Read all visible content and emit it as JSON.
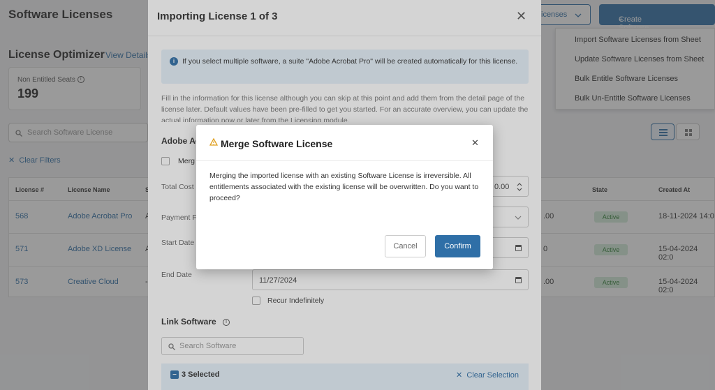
{
  "page": {
    "title": "Software Licenses",
    "subtitle": "License Optimizer",
    "view_details": "View Details",
    "stat_label": "Non Entitled Seats",
    "stat_value": "199",
    "search_placeholder": "Search Software License",
    "clear_filters": "Clear Filters",
    "top_button_outline": "icenses",
    "top_button_primary": "Create Software License",
    "dropdown": [
      "Import Software Licenses from Sheet",
      "Update Software Licenses from Sheet",
      "Bulk Entitle Software Licenses",
      "Bulk Un-Entitle Software Licenses"
    ],
    "table": {
      "headers": [
        "License #",
        "License Name",
        "S",
        "State",
        "Created At"
      ],
      "rows": [
        {
          "num": "568",
          "name": "Adobe Acrobat Pro",
          "s": "A",
          "amount": ".00",
          "state": "Active",
          "created": "18-11-2024 14:0"
        },
        {
          "num": "571",
          "name": "Adobe XD License",
          "s": "A",
          "amount": "0",
          "state": "Active",
          "created": "15-04-2024 02:0"
        },
        {
          "num": "573",
          "name": "Creative Cloud",
          "s": "-",
          "amount": ".00",
          "state": "Active",
          "created": "15-04-2024 02:0"
        }
      ]
    }
  },
  "import_modal": {
    "title": "Importing License 1 of 3",
    "info": "If you select multiple software, a suite \"Adobe Acrobat Pro\" will be created automatically for this license.",
    "help": "Fill in the information for this license although you can skip at this point and add them from the detail page of the license later. Default values have been pre-filled to get you started. For an accurate overview, you can update the actual information now or later from the Licensing module.",
    "section_title": "Adobe Ac",
    "merge_checkbox_label": "Merg",
    "labels": {
      "total_cost": "Total Cost",
      "payment": "Payment F",
      "start_date": "Start Date",
      "end_date": "End Date"
    },
    "total_cost_value": "0.00",
    "end_date_value": "11/27/2024",
    "recur_label": "Recur Indefinitely",
    "link_software_title": "Link Software",
    "search_software_placeholder": "Search Software",
    "selected_label": "3 Selected",
    "clear_selection": "Clear Selection"
  },
  "merge_modal": {
    "title": "Merge Software License",
    "body": "Merging the imported license with an existing Software License is irreversible. All entitlements associated with the existing license will be overwritten. Do you want to proceed?",
    "cancel": "Cancel",
    "confirm": "Confirm"
  }
}
